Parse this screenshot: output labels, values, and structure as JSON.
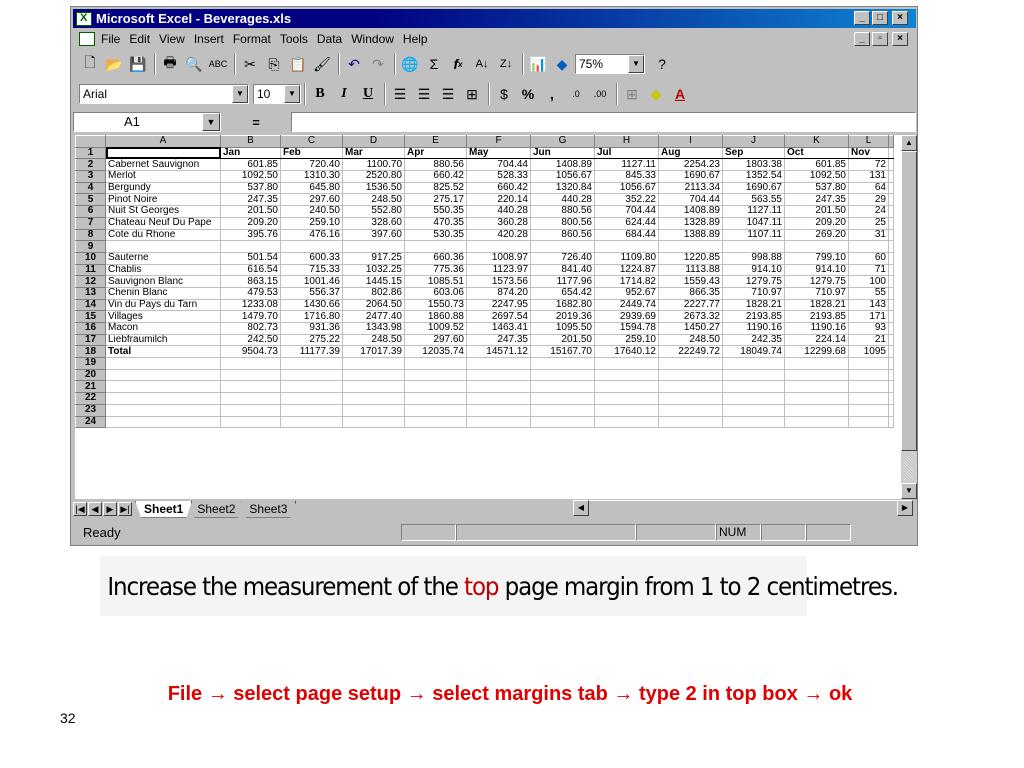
{
  "window": {
    "title": "Microsoft Excel - Beverages.xls"
  },
  "menu": [
    "File",
    "Edit",
    "View",
    "Insert",
    "Format",
    "Tools",
    "Data",
    "Window",
    "Help"
  ],
  "toolbar": {
    "zoom": "75%",
    "font": "Arial",
    "font_size": "10",
    "bold": "B",
    "italic": "I",
    "underline": "U",
    "percent": "%",
    "comma": ",",
    "sigma": "Σ",
    "fx": "f",
    "fx_sub": "x"
  },
  "formula_bar": {
    "name_box": "A1",
    "equals": "="
  },
  "columns": [
    "A",
    "B",
    "C",
    "D",
    "E",
    "F",
    "G",
    "H",
    "I",
    "J",
    "K",
    "L"
  ],
  "header_row": [
    "",
    "Jan",
    "Feb",
    "Mar",
    "Apr",
    "May",
    "Jun",
    "Jul",
    "Aug",
    "Sep",
    "Oct",
    "Nov"
  ],
  "rows": [
    [
      "Cabernet Sauvignon",
      "601.85",
      "720.40",
      "1100.70",
      "880.56",
      "704.44",
      "1408.89",
      "1127.11",
      "2254.23",
      "1803.38",
      "601.85",
      "72"
    ],
    [
      "Merlot",
      "1092.50",
      "1310.30",
      "2520.80",
      "660.42",
      "528.33",
      "1056.67",
      "845.33",
      "1690.67",
      "1352.54",
      "1092.50",
      "131"
    ],
    [
      "Bergundy",
      "537.80",
      "645.80",
      "1536.50",
      "825.52",
      "660.42",
      "1320.84",
      "1056.67",
      "2113.34",
      "1690.67",
      "537.80",
      "64"
    ],
    [
      "Pinot Noire",
      "247.35",
      "297.60",
      "248.50",
      "275.17",
      "220.14",
      "440.28",
      "352.22",
      "704.44",
      "563.55",
      "247.35",
      "29"
    ],
    [
      "Nuit St Georges",
      "201.50",
      "240.50",
      "552.80",
      "550.35",
      "440.28",
      "880.56",
      "704.44",
      "1408.89",
      "1127.11",
      "201.50",
      "24"
    ],
    [
      "Chateau Neuf Du Pape",
      "209.20",
      "259.10",
      "328.60",
      "470.35",
      "360.28",
      "800.56",
      "624.44",
      "1328.89",
      "1047.11",
      "209.20",
      "25"
    ],
    [
      "Cote du Rhone",
      "395.76",
      "476.16",
      "397.60",
      "530.35",
      "420.28",
      "860.56",
      "684.44",
      "1388.89",
      "1107.11",
      "269.20",
      "31"
    ],
    [
      "",
      "",
      "",
      "",
      "",
      "",
      "",
      "",
      "",
      "",
      "",
      ""
    ],
    [
      "Sauterne",
      "501.54",
      "600.33",
      "917.25",
      "660.36",
      "1008.97",
      "726.40",
      "1109.80",
      "1220.85",
      "998.88",
      "799.10",
      "60"
    ],
    [
      "Chablis",
      "616.54",
      "715.33",
      "1032.25",
      "775.36",
      "1123.97",
      "841.40",
      "1224.87",
      "1113.88",
      "914.10",
      "914.10",
      "71"
    ],
    [
      "Sauvignon Blanc",
      "863.15",
      "1001.46",
      "1445.15",
      "1085.51",
      "1573.56",
      "1177.96",
      "1714.82",
      "1559.43",
      "1279.75",
      "1279.75",
      "100"
    ],
    [
      "Chenin Blanc",
      "479.53",
      "556.37",
      "802.86",
      "603.06",
      "874.20",
      "654.42",
      "952.67",
      "866.35",
      "710.97",
      "710.97",
      "55"
    ],
    [
      "Vin du Pays du Tarn",
      "1233.08",
      "1430.66",
      "2064.50",
      "1550.73",
      "2247.95",
      "1682.80",
      "2449.74",
      "2227.77",
      "1828.21",
      "1828.21",
      "143"
    ],
    [
      "Villages",
      "1479.70",
      "1716.80",
      "2477.40",
      "1860.88",
      "2697.54",
      "2019.36",
      "2939.69",
      "2673.32",
      "2193.85",
      "2193.85",
      "171"
    ],
    [
      "Macon",
      "802.73",
      "931.36",
      "1343.98",
      "1009.52",
      "1463.41",
      "1095.50",
      "1594.78",
      "1450.27",
      "1190.16",
      "1190.16",
      "93"
    ],
    [
      "Liebfraumilch",
      "242.50",
      "275.22",
      "248.50",
      "297.60",
      "247.35",
      "201.50",
      "259.10",
      "248.50",
      "242.35",
      "224.14",
      "21"
    ],
    [
      "Total",
      "9504.73",
      "11177.39",
      "17017.39",
      "12035.74",
      "14571.12",
      "15167.70",
      "17640.12",
      "22249.72",
      "18049.74",
      "12299.68",
      "1095"
    ]
  ],
  "empty_rows": [
    "19",
    "20",
    "21",
    "22",
    "23",
    "24"
  ],
  "sheet_tabs": [
    "Sheet1",
    "Sheet2",
    "Sheet3"
  ],
  "status": {
    "text": "Ready",
    "num": "NUM"
  },
  "instruction": {
    "pre": "Increase the measurement of the ",
    "highlight": "top",
    "post": " page margin from 1 to 2 centimetres."
  },
  "answer": "File → select page setup → select margins tab → type 2 in top box → ok",
  "page_number": "32"
}
